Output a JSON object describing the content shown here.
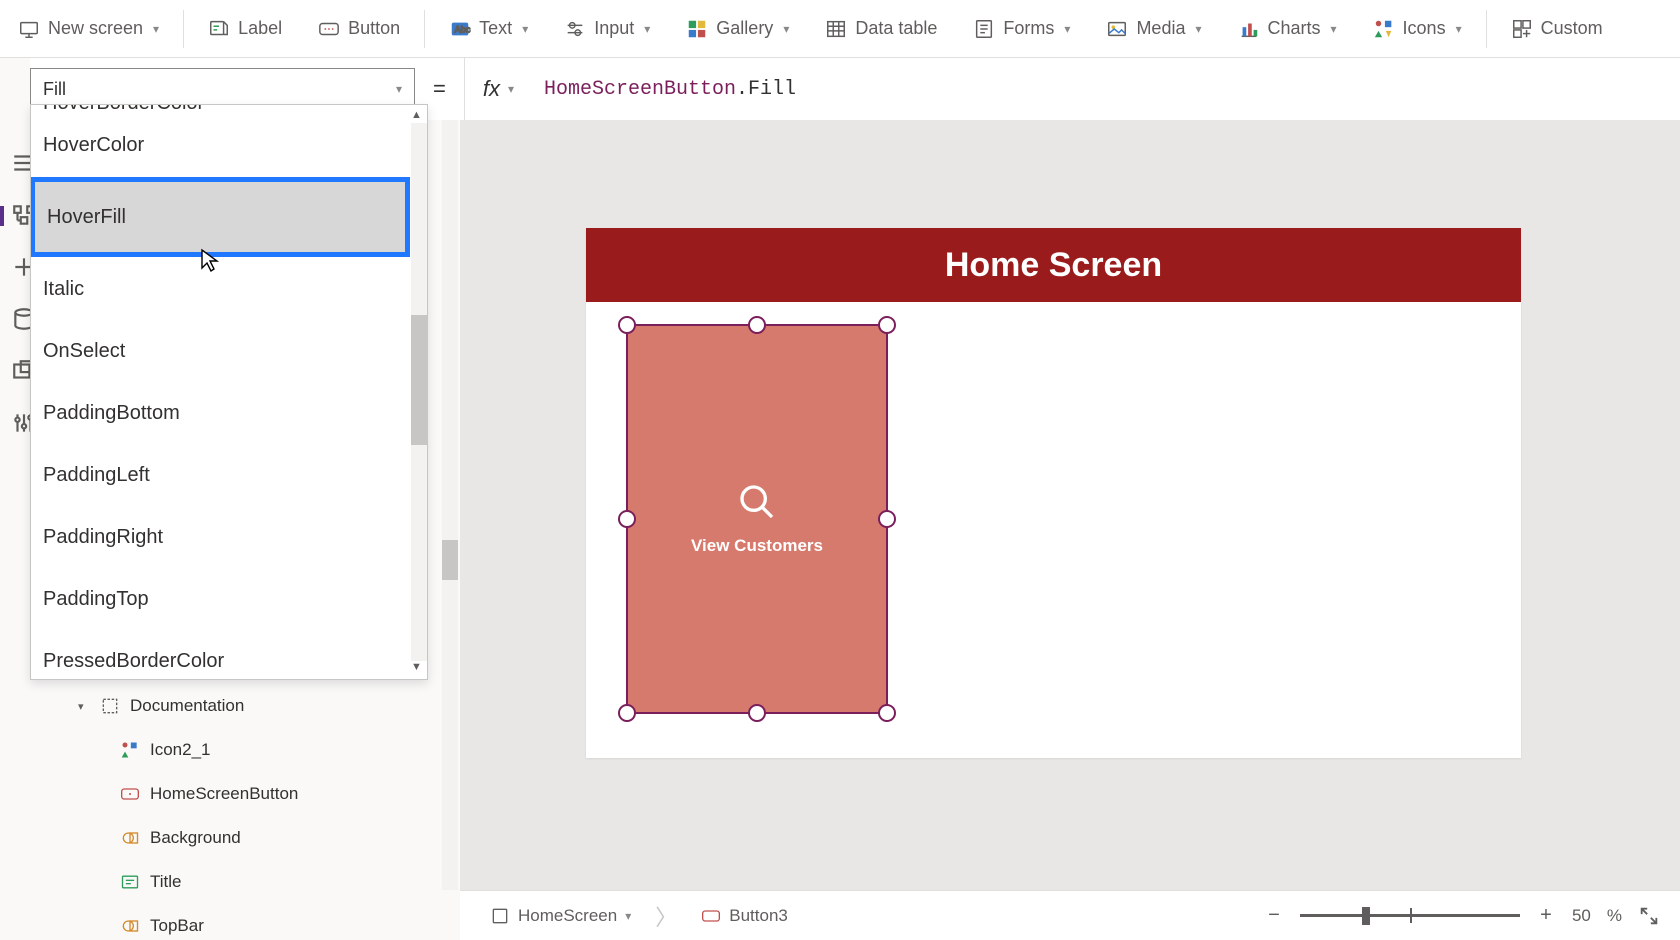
{
  "ribbon": {
    "new_screen": "New screen",
    "label": "Label",
    "button": "Button",
    "text": "Text",
    "input": "Input",
    "gallery": "Gallery",
    "data_table": "Data table",
    "forms": "Forms",
    "media": "Media",
    "charts": "Charts",
    "icons": "Icons",
    "custom": "Custom"
  },
  "formula": {
    "selected_property": "Fill",
    "object": "HomeScreenButton",
    "prop": ".Fill"
  },
  "property_list": {
    "clipped_top": "HoverBorderColor",
    "items": [
      "HoverColor",
      "HoverFill",
      "Italic",
      "OnSelect",
      "PaddingBottom",
      "PaddingLeft",
      "PaddingRight",
      "PaddingTop",
      "PressedBorderColor"
    ],
    "highlighted_index": 1
  },
  "tree": {
    "group": "Documentation",
    "items": [
      "Icon2_1",
      "HomeScreenButton",
      "Background",
      "Title",
      "TopBar"
    ]
  },
  "canvas": {
    "header": "Home Screen",
    "button_label": "View Customers"
  },
  "status": {
    "crumb1": "HomeScreen",
    "crumb2": "Button3",
    "zoom_value": "50",
    "zoom_pct": "%"
  }
}
